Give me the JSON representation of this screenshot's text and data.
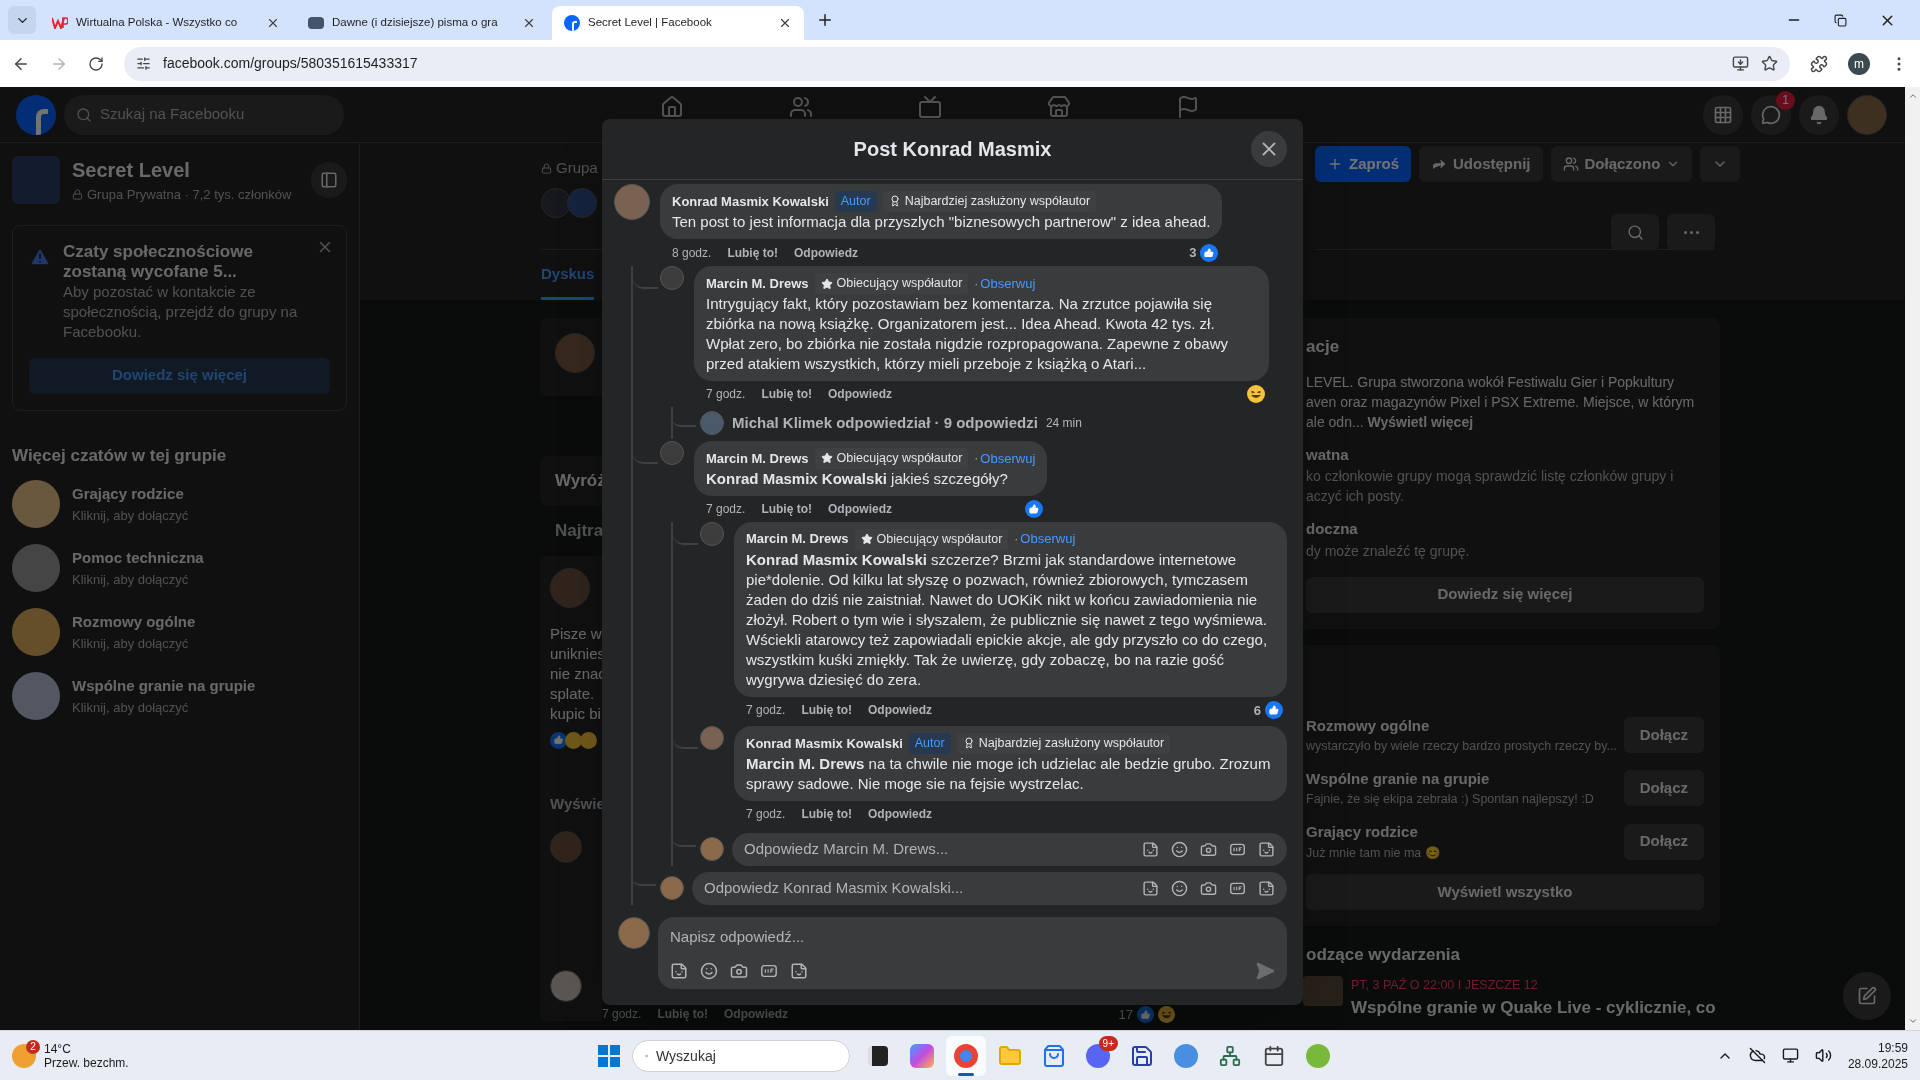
{
  "browser": {
    "tabs": [
      {
        "title": "Wirtualna Polska - Wszystko co",
        "kind": "wp",
        "selected": false
      },
      {
        "title": "Dawne (i dzisiejsze) pisma o gra",
        "kind": "site",
        "selected": false
      },
      {
        "title": "Secret Level | Facebook",
        "kind": "facebook",
        "selected": true
      }
    ],
    "url": "facebook.com/groups/580351615433317",
    "profile_initial": "m"
  },
  "facebook": {
    "search_placeholder": "Szukaj na Facebooku",
    "messenger_badge": "1",
    "sidebar": {
      "group_name": "Secret Level",
      "group_meta": "Grupa Prywatna · 7,2 tys. członków",
      "notice": {
        "title": "Czaty społecznościowe zostaną wycofane 5...",
        "body": "Aby pozostać w kontakcie ze społecznością, przejdź do grupy na Facebooku.",
        "button": "Dowiedz się więcej"
      },
      "chats_heading": "Więcej czatów w tej grupie",
      "chats": [
        {
          "name": "Grający rodzice",
          "hint": "Kliknij, aby dołączyć"
        },
        {
          "name": "Pomoc techniczna",
          "hint": "Kliknij, aby dołączyć"
        },
        {
          "name": "Rozmowy ogólne",
          "hint": "Kliknij, aby dołączyć"
        },
        {
          "name": "Wspólne granie na grupie",
          "hint": "Kliknij, aby dołączyć"
        }
      ]
    },
    "group_header": {
      "privacy": "Grupa",
      "tabs": [
        {
          "label": "Dyskus",
          "selected": true
        }
      ],
      "buttons": [
        {
          "label": "Zaproś",
          "kind": "invite"
        },
        {
          "label": "Udostępnij",
          "kind": "share"
        },
        {
          "label": "Dołączono",
          "kind": "joined"
        },
        {
          "kind": "more"
        }
      ]
    },
    "feed": {
      "featured": "Wyróż",
      "sort": "Najtra",
      "post_lines": [
        "Pisze w",
        "uniknies",
        "nie znac",
        "splate.",
        "kupic bi"
      ],
      "show_more": "Wyświe",
      "bottom_actions": [
        "7 godz.",
        "Lubię to!",
        "Odpowiedz"
      ],
      "bottom_count": "17"
    },
    "about": {
      "heading": "acje",
      "description": [
        "LEVEL. Grupa stworzona wokół Festiwalu Gier i Popkultury",
        "aven oraz magazynów Pixel i PSX Extreme. Miejsce, w którym",
        "ale odn... **Wyświetl więcej**"
      ],
      "sections": [
        {
          "title": "watna",
          "lines": [
            "ko członkowie grupy mogą sprawdzić listę członków grupy i",
            "aczyć ich posty."
          ]
        },
        {
          "title": "doczna",
          "lines": [
            "dy może znaleźć tę grupę."
          ]
        }
      ],
      "button": "Dowiedz się więcej"
    },
    "chats": {
      "items": [
        {
          "name": "Rozmowy ogólne",
          "hint": "wystarczyło by wiele rzeczy bardzo prostych rzeczy by...",
          "button": "Dołącz"
        },
        {
          "name": "Wspólne granie na grupie",
          "hint": "Fajnie, że się ekipa zebrała :) Spontan najlepszy! :D",
          "button": "Dołącz"
        },
        {
          "name": "Grający rodzice",
          "hint": "Już mnie tam nie ma 😊",
          "button": "Dołącz"
        }
      ],
      "show_all": "Wyświetl wszystko"
    },
    "events": {
      "heading": "odzące wydarzenia",
      "date": "PT, 3 PAŹ O 22:00 I JESZCZE 12",
      "title": "Wspólne granie w Quake Live - cyklicznie, co"
    }
  },
  "modal": {
    "title": "Post Konrad Masmix",
    "comments": [
      {
        "author": "Konrad Masmix Kowalski",
        "badges": [
          {
            "label": "Autor",
            "kind": "author"
          },
          {
            "label": "Najbardziej zasłużony współautor",
            "kind": "top"
          }
        ],
        "text": "Ten post to jest informacja dla przyszlych \"biznesowych partnerow\" z idea ahead.",
        "time": "8 godz.",
        "like": "Lubię to!",
        "reply": "Odpowiedz",
        "reactions": {
          "count": "3",
          "kind": "like"
        },
        "children": [
          {
            "author": "Marcin M. Drews",
            "badges": [
              {
                "label": "Obiecujący współautor",
                "kind": "rising"
              }
            ],
            "follow_sep": "·",
            "follow": "Obserwuj",
            "text": "Intrygujący fakt, który pozostawiam bez komentarza. Na zrzutce pojawiła się zbiórka na nową książkę. Organizatorem jest... Idea Ahead. Kwota 42 tys. zł. Wpłat zero, bo zbiórka nie została nigdzie rozpropagowana. Zapewne z obawy przed atakiem wszystkich, którzy mieli przeboje z książką o Atari...",
            "time": "7 godz.",
            "like": "Lubię to!",
            "reply": "Odpowiedz",
            "reactions": {
              "kind": "haha"
            },
            "summary": {
              "text": "Michal Klimek odpowiedział · 9 odpowiedzi",
              "time": "24 min"
            }
          },
          {
            "author": "Marcin M. Drews",
            "badges": [
              {
                "label": "Obiecujący współautor",
                "kind": "rising"
              }
            ],
            "follow_sep": "·",
            "follow": "Obserwuj",
            "text": "**Konrad Masmix Kowalski** jakieś szczegóły?",
            "time": "7 godz.",
            "like": "Lubię to!",
            "reply": "Odpowiedz",
            "reactions": {
              "kind": "like"
            },
            "children": [
              {
                "author": "Marcin M. Drews",
                "badges": [
                  {
                    "label": "Obiecujący współautor",
                    "kind": "rising"
                  }
                ],
                "follow_sep": "·",
                "follow": "Obserwuj",
                "text": "**Konrad Masmix Kowalski** szczerze? Brzmi jak standardowe internetowe pie*dolenie. Od kilku lat słyszę o pozwach, również zbiorowych, tymczasem żaden do dziś nie zaistniał. Nawet do UOKiK nikt w końcu zawiadomienia nie złożył. Robert o tym wie i słyszalem, że publicznie się nawet z tego wyśmiewa. Wściekli atarowcy też zapowiadali epickie akcje, ale gdy przyszło co do czego, wszystkim kuśki zmiękły. Tak że uwierzę, gdy zobaczę, bo na razie gość wygrywa dziesięć do zera.",
                "time": "7 godz.",
                "like": "Lubię to!",
                "reply": "Odpowiedz",
                "reactions": {
                  "count": "6",
                  "kind": "like"
                }
              },
              {
                "author": "Konrad Masmix Kowalski",
                "badges": [
                  {
                    "label": "Autor",
                    "kind": "author"
                  },
                  {
                    "label": "Najbardziej zasłużony współautor",
                    "kind": "top"
                  }
                ],
                "text": "**Marcin M. Drews** na ta chwile nie moge ich udzielac ale bedzie grubo. Zrozum sprawy sadowe. Nie moge sie na fejsie wystrzelac.",
                "time": "7 godz.",
                "like": "Lubię to!",
                "reply": "Odpowiedz"
              }
            ],
            "reply_field": {
              "placeholder": "Odpowiedz Marcin M. Drews..."
            }
          }
        ],
        "reply_field": {
          "placeholder": "Odpowiedz Konrad Masmix Kowalski..."
        }
      }
    ],
    "composer": {
      "placeholder": "Napisz odpowiedź..."
    }
  },
  "taskbar": {
    "weather": {
      "badge": "2",
      "temp": "14°C",
      "desc": "Przew. bezchm."
    },
    "search_placeholder": "Wyszukaj",
    "apps": [
      {
        "kind": "terminal",
        "active": false
      },
      {
        "kind": "copilot",
        "active": false
      },
      {
        "kind": "browser",
        "active": true
      },
      {
        "kind": "folder",
        "active": false
      },
      {
        "kind": "store",
        "active": false
      },
      {
        "kind": "chat",
        "active": false,
        "badge": "9+"
      },
      {
        "kind": "floppy",
        "active": false
      },
      {
        "kind": "torrent-blue",
        "active": false
      },
      {
        "kind": "network",
        "active": false
      },
      {
        "kind": "calendar",
        "active": false
      },
      {
        "kind": "torrent-green",
        "active": false
      }
    ],
    "time": "19:59",
    "date": "28.09.2025"
  }
}
